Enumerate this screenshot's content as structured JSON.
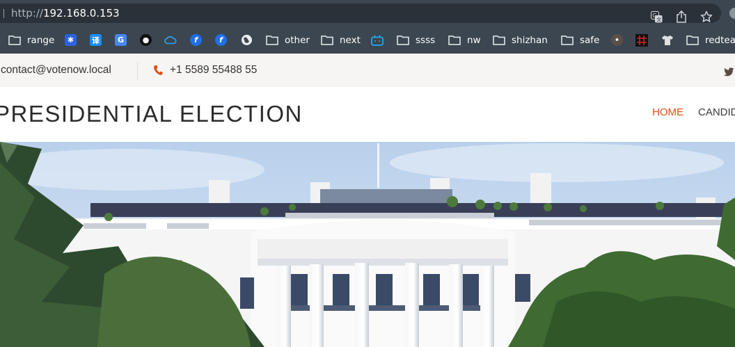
{
  "browser": {
    "url_protocol": "http://",
    "url_host": "192.168.0.153",
    "icons": [
      "translate-icon",
      "share-icon",
      "star-icon"
    ]
  },
  "bookmarks": [
    {
      "label": "range",
      "icon": "folder-icon"
    },
    {
      "label": "",
      "icon": "baidu-icon"
    },
    {
      "label": "",
      "icon": "translate-icon"
    },
    {
      "label": "",
      "icon": "google-translate-icon"
    },
    {
      "label": "",
      "icon": "github-icon"
    },
    {
      "label": "",
      "icon": "cloud-icon"
    },
    {
      "label": "",
      "icon": "f-icon"
    },
    {
      "label": "",
      "icon": "f-icon"
    },
    {
      "label": "",
      "icon": "globe-icon"
    },
    {
      "label": "other",
      "icon": "folder-icon"
    },
    {
      "label": "next",
      "icon": "folder-icon"
    },
    {
      "label": "",
      "icon": "bilibili-icon"
    },
    {
      "label": "ssss",
      "icon": "folder-icon"
    },
    {
      "label": "nw",
      "icon": "folder-icon"
    },
    {
      "label": "shizhan",
      "icon": "folder-icon"
    },
    {
      "label": "safe",
      "icon": "folder-icon"
    },
    {
      "label": "",
      "icon": "bird-icon"
    },
    {
      "label": "",
      "icon": "grid-icon"
    },
    {
      "label": "",
      "icon": "shirt-icon"
    },
    {
      "label": "redteam",
      "icon": "folder-icon"
    }
  ],
  "topbar": {
    "email": "contact@votenow.local",
    "phone": "+1 5589 55488 55"
  },
  "header": {
    "title": "PRESIDENTIAL ELECTION",
    "nav": {
      "home": "HOME",
      "candidates": "CANDIDATES"
    }
  },
  "colors": {
    "browser_bar": "#3b4650",
    "url_box": "#2a3138",
    "accent": "#e04e1a",
    "topbar_bg": "#f6f5f3"
  }
}
